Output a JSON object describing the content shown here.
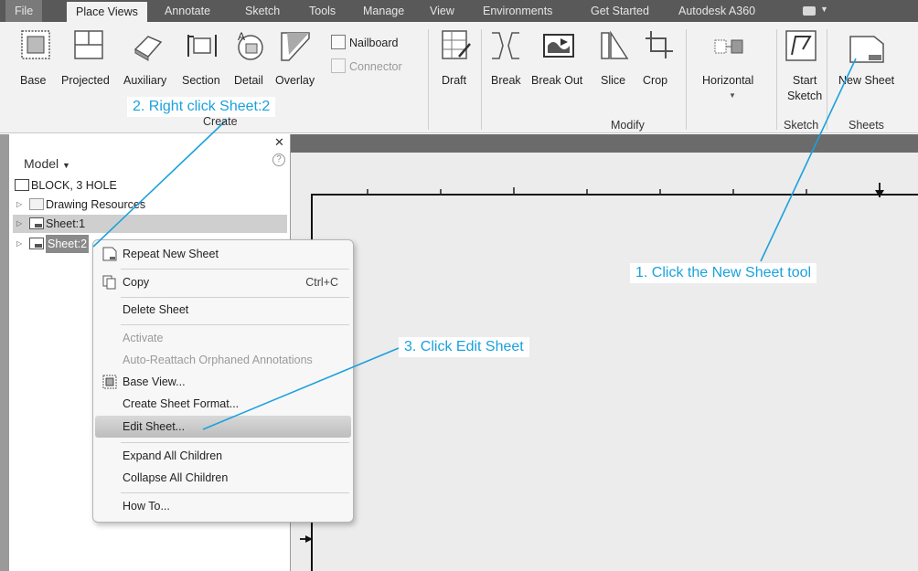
{
  "tabs": [
    "File",
    "Place Views",
    "Annotate",
    "Sketch",
    "Tools",
    "Manage",
    "View",
    "Environments",
    "Get Started",
    "Autodesk A360"
  ],
  "active_tab": "Place Views",
  "ribbon": {
    "create": {
      "buttons": [
        "Base",
        "Projected",
        "Auxiliary",
        "Section",
        "Detail",
        "Overlay"
      ],
      "nailboard": "Nailboard",
      "connector": "Connector",
      "label": "Create"
    },
    "draft": "Draft",
    "modify": {
      "buttons": [
        "Break",
        "Break Out",
        "Slice",
        "Crop"
      ],
      "label": "Modify"
    },
    "horizontal": "Horizontal",
    "sketch": {
      "line1": "Start",
      "line2": "Sketch",
      "label": "Sketch"
    },
    "sheets": {
      "button": "New Sheet",
      "label": "Sheets"
    }
  },
  "browser": {
    "title": "Model",
    "items": [
      "BLOCK, 3 HOLE",
      "Drawing Resources",
      "Sheet:1",
      "Sheet:2"
    ]
  },
  "context_menu": {
    "repeat": "Repeat New Sheet",
    "copy": "Copy",
    "copy_shortcut": "Ctrl+C",
    "delete": "Delete Sheet",
    "activate": "Activate",
    "auto_reattach": "Auto-Reattach Orphaned Annotations",
    "base_view": "Base View...",
    "create_format": "Create Sheet Format...",
    "edit_sheet": "Edit Sheet...",
    "expand": "Expand All Children",
    "collapse": "Collapse All Children",
    "how_to": "How To..."
  },
  "callouts": {
    "step1": "1. Click the New Sheet tool",
    "step2": "2. Right click Sheet:2",
    "step3": "3. Click Edit Sheet"
  },
  "colors": {
    "callout": "#1ba1dd",
    "tabbar": "#595959",
    "ribbon": "#f2f2f2"
  }
}
